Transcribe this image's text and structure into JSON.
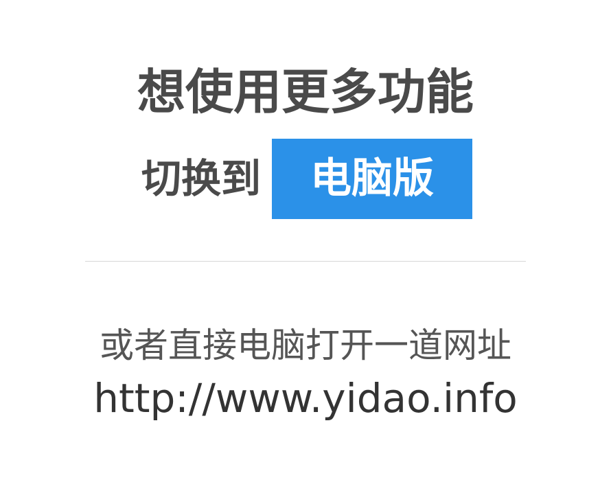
{
  "headline": "想使用更多功能",
  "switch": {
    "prefix": "切换到",
    "button_label": "电脑版",
    "button_color": "#2b91e8"
  },
  "alternative": {
    "text": "或者直接电脑打开一道网址",
    "url": "http://www.yidao.info"
  }
}
